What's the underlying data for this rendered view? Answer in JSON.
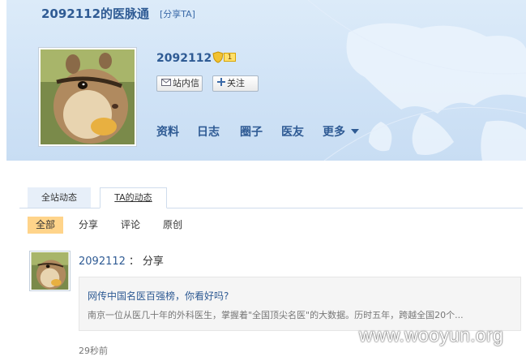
{
  "header": {
    "title": "2092112的医脉通",
    "share_ta": "[分享TA]"
  },
  "profile": {
    "username": "2092112",
    "level": "1",
    "message_button": "站内信",
    "follow_button": "关注",
    "nav": [
      "资料",
      "日志",
      "圈子",
      "医友",
      "更多"
    ]
  },
  "tabs": [
    {
      "label": "全站动态",
      "active": false
    },
    {
      "label": "TA的动态",
      "active": true
    }
  ],
  "filters": [
    {
      "label": "全部",
      "active": true
    },
    {
      "label": "分享",
      "active": false
    },
    {
      "label": "评论",
      "active": false
    },
    {
      "label": "原创",
      "active": false
    }
  ],
  "feed": {
    "user": "2092112",
    "separator": "：",
    "action": "分享",
    "card": {
      "title": "网传中国名医百强榜，你看好吗?",
      "summary": "南京一位从医几十年的外科医生，掌握着\"全国顶尖名医\"的大数据。历时五年，跨越全国20个..."
    },
    "time": "29秒前"
  },
  "watermark": "www.wooyun.org",
  "colors": {
    "link_blue": "#2f5b94",
    "banner_bg": "#cfe2f6",
    "active_filter": "#ffd48a"
  }
}
